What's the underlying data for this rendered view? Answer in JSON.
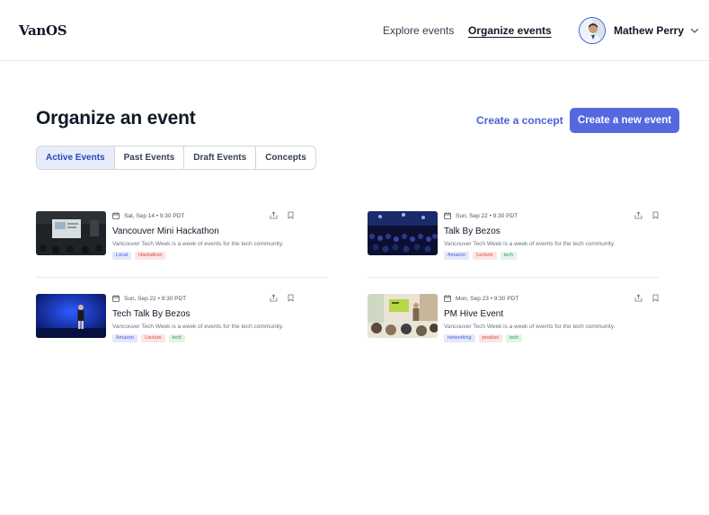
{
  "header": {
    "logo": "VanOS",
    "nav": {
      "explore": "Explore events",
      "organize": "Organize events"
    },
    "user": {
      "name": "Mathew Perry"
    }
  },
  "main": {
    "title": "Organize an event",
    "create_concept": "Create a concept",
    "create_event": "Create a new event",
    "tabs": [
      "Active Events",
      "Past Events",
      "Draft Events",
      "Concepts"
    ],
    "active_tab": "Active Events"
  },
  "events": [
    {
      "date": "Sat, Sep 14 • 9:30 PDT",
      "title": "Vancouver Mini Hackathon",
      "description": "Vancouver Tech Week is a week of events for the tech community.",
      "tags": [
        {
          "label": "Local",
          "color": "blue"
        },
        {
          "label": "Hackathon",
          "color": "red"
        }
      ]
    },
    {
      "date": "Sun, Sep 22 • 9:30 PDT",
      "title": "Talk By Bezos",
      "description": "Vancouver Tech Week is a week of events for the tech community.",
      "tags": [
        {
          "label": "Amazon",
          "color": "blue"
        },
        {
          "label": "Lecture",
          "color": "red"
        },
        {
          "label": "tech",
          "color": "green"
        }
      ]
    },
    {
      "date": "Sun, Sep 22 • 9:30 PDT",
      "title": "Tech Talk By Bezos",
      "description": "Vancouver Tech Week is a week of events for the tech community.",
      "tags": [
        {
          "label": "Amazon",
          "color": "blue"
        },
        {
          "label": "Lecture",
          "color": "red"
        },
        {
          "label": "tech",
          "color": "green"
        }
      ]
    },
    {
      "date": "Mon, Sep 23 • 9:30 PDT",
      "title": "PM Hive Event",
      "description": "Vancouver Tech Week is a week of events for the tech community.",
      "tags": [
        {
          "label": "networking",
          "color": "blue"
        },
        {
          "label": "product",
          "color": "red"
        },
        {
          "label": "tech",
          "color": "green"
        }
      ]
    }
  ],
  "colors": {
    "accent": "#5468e0",
    "link": "#4a61d6",
    "tab_active_bg": "#e7ecfb",
    "tag_blue_bg": "#e3e8fb",
    "tag_red_bg": "#fde4e4",
    "tag_green_bg": "#e1f5e6"
  },
  "icons": [
    "calendar-icon",
    "share-icon",
    "bookmark-icon",
    "chevron-down-icon"
  ]
}
